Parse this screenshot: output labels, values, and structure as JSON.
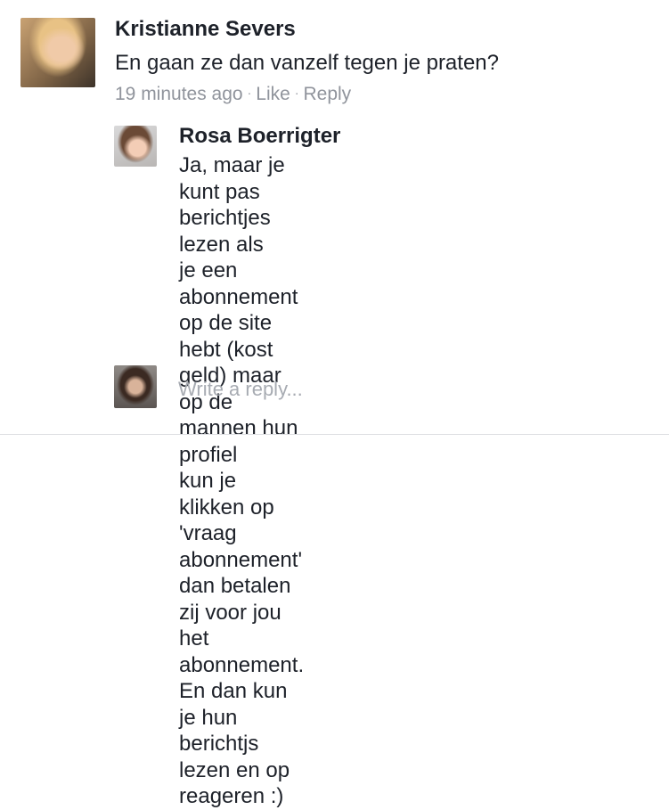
{
  "comment": {
    "author": "Kristianne Severs",
    "text": "En gaan ze dan vanzelf tegen je praten?",
    "time": "19 minutes ago",
    "like_label": "Like",
    "reply_label": "Reply",
    "separator": "·"
  },
  "reply": {
    "author": "Rosa Boerrigter",
    "lines": [
      "Ja, maar je kunt pas berichtjes lezen als",
      "je een abonnement op de site hebt (kost",
      "geld) maar op de mannen hun profiel",
      "kun je klikken op 'vraag abonnement'",
      "dan betalen zij voor jou het abonnement.",
      "En dan kun je hun berichtjs lezen en op",
      "reageren :)"
    ]
  },
  "composer": {
    "placeholder": "Write a reply..."
  }
}
